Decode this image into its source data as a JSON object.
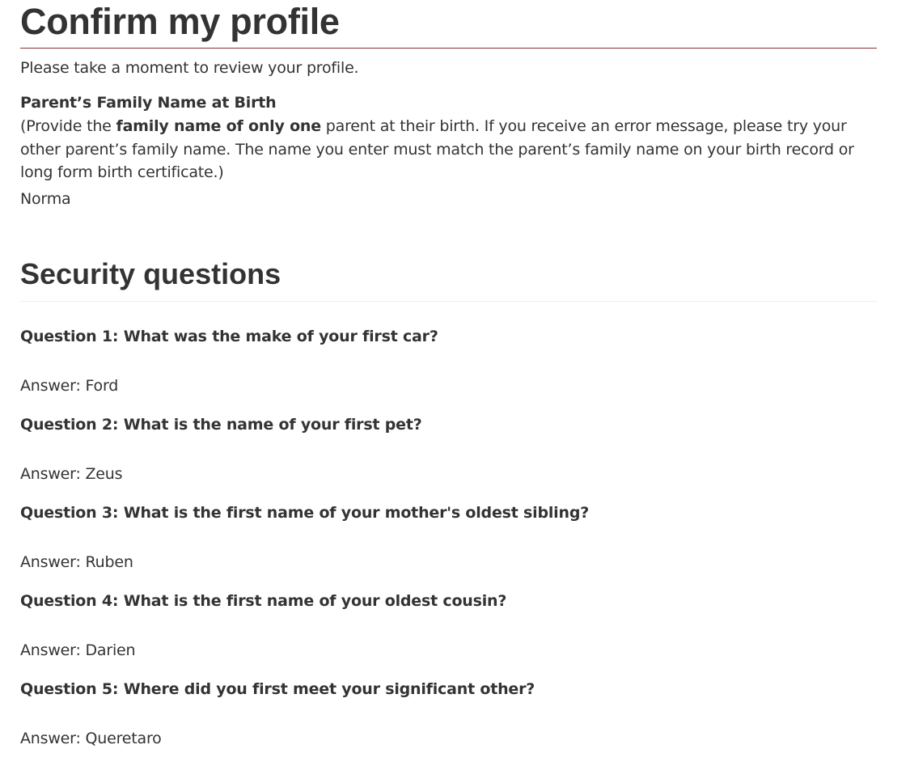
{
  "page": {
    "title": "Confirm my profile",
    "intro": "Please take a moment to review your profile."
  },
  "parent_name_field": {
    "label": "Parent’s Family Name at Birth",
    "help_prefix": "(Provide the ",
    "help_bold": "family name of only one",
    "help_suffix": " parent at their birth. If you receive an error message, please try your other parent’s family name. The name you enter must match the parent’s family name on your birth record or long form birth certificate.)",
    "value": "Norma"
  },
  "security": {
    "title": "Security questions",
    "items": [
      {
        "question": "Question 1: What was the make of your first car?",
        "answer": "Answer: Ford"
      },
      {
        "question": "Question 2: What is the name of your first pet?",
        "answer": "Answer: Zeus"
      },
      {
        "question": "Question 3: What is the first name of your mother's oldest sibling?",
        "answer": "Answer: Ruben"
      },
      {
        "question": "Question 4: What is the first name of your oldest cousin?",
        "answer": "Answer: Darien"
      },
      {
        "question": "Question 5: Where did you first meet your significant other?",
        "answer": "Answer: Queretaro"
      }
    ]
  },
  "colors": {
    "text": "#333333",
    "title_rule": "#8b2f2f",
    "section_rule": "#eeeeee",
    "background": "#ffffff"
  }
}
